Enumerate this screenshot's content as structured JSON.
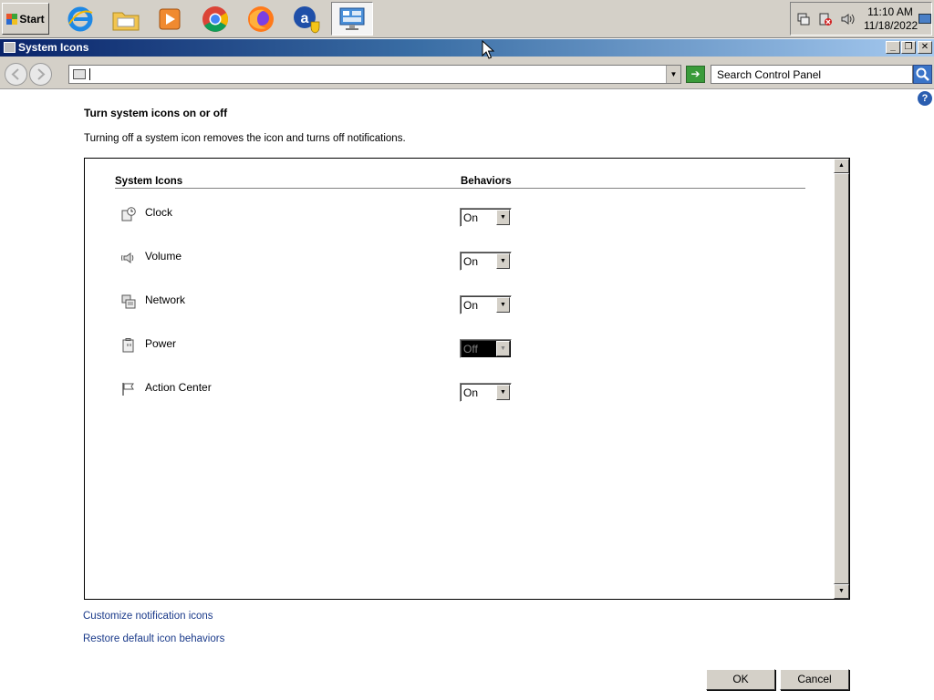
{
  "taskbar": {
    "start_label": "Start",
    "apps": [
      {
        "name": "internet-explorer",
        "icon": "ie-icon"
      },
      {
        "name": "file-explorer",
        "icon": "folder-icon"
      },
      {
        "name": "media-player",
        "icon": "media-player-icon"
      },
      {
        "name": "chrome",
        "icon": "chrome-icon"
      },
      {
        "name": "firefox",
        "icon": "firefox-icon"
      },
      {
        "name": "internet-explorer-update",
        "icon": "ie-shield-icon"
      },
      {
        "name": "control-panel",
        "icon": "control-panel-icon",
        "active": true
      }
    ],
    "tray": {
      "icons": [
        "network-tray-icon",
        "power-tray-icon",
        "volume-tray-icon"
      ],
      "time": "11:10 AM",
      "date": "11/18/2022"
    }
  },
  "window": {
    "title": "System Icons",
    "controls": [
      "minimize",
      "restore",
      "close"
    ]
  },
  "address_bar": {
    "address_value": "",
    "search_placeholder": "Search Control Panel"
  },
  "content": {
    "heading": "Turn system icons on or off",
    "description": "Turning off a system icon removes the icon and turns off notifications.",
    "columns": {
      "system_icons": "System Icons",
      "behaviors": "Behaviors"
    },
    "rows": [
      {
        "label": "Clock",
        "icon": "clock-icon",
        "value": "On",
        "enabled": true
      },
      {
        "label": "Volume",
        "icon": "volume-icon",
        "value": "On",
        "enabled": true
      },
      {
        "label": "Network",
        "icon": "network-icon",
        "value": "On",
        "enabled": true
      },
      {
        "label": "Power",
        "icon": "power-icon",
        "value": "Off",
        "enabled": false
      },
      {
        "label": "Action Center",
        "icon": "flag-icon",
        "value": "On",
        "enabled": true
      }
    ],
    "links": {
      "customize": "Customize notification icons",
      "restore": "Restore default icon behaviors"
    },
    "buttons": {
      "ok": "OK",
      "cancel": "Cancel"
    }
  },
  "colors": {
    "title_bar_start": "#0a246a",
    "title_bar_end": "#a6caf0",
    "link": "#1a3a8a",
    "face": "#d4d0c8"
  }
}
